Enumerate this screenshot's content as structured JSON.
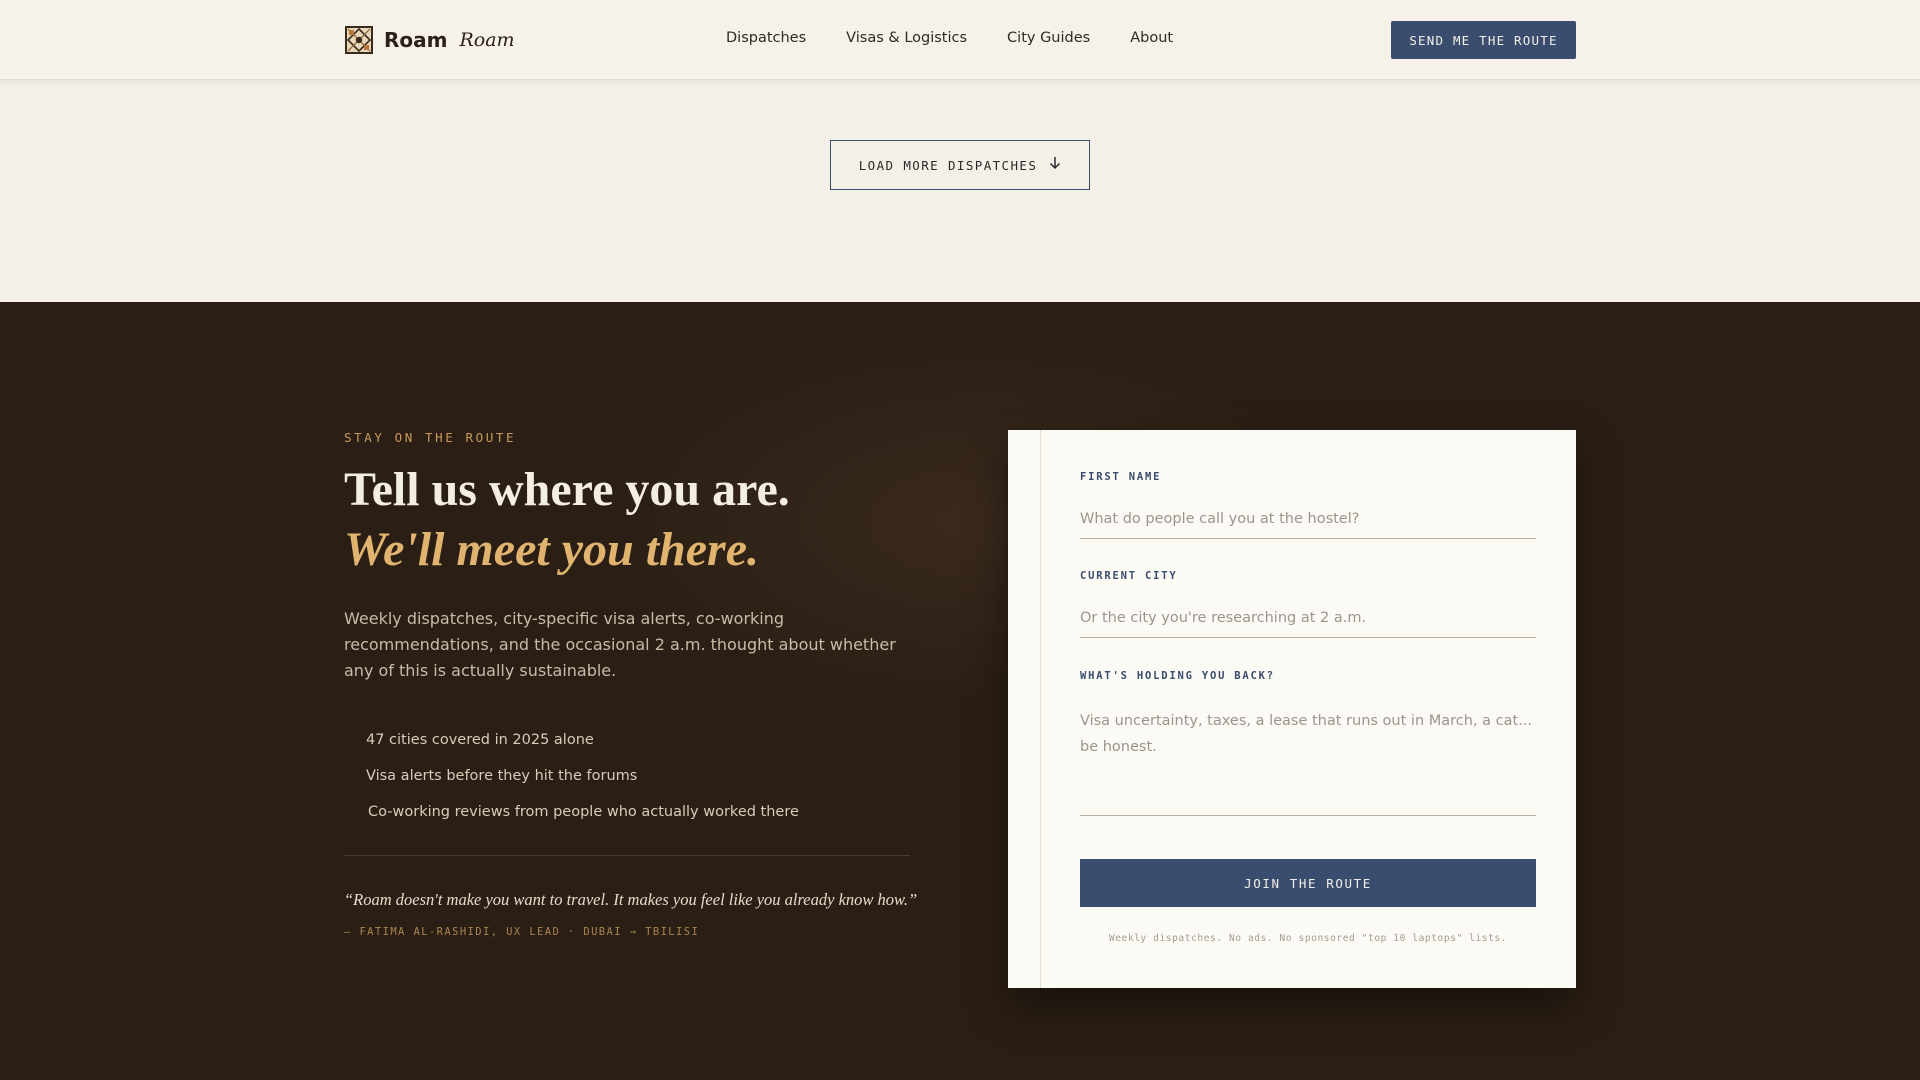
{
  "header": {
    "brand_name": "Roam",
    "brand_tagline": "Roam",
    "nav": [
      "Dispatches",
      "Visas & Logistics",
      "City Guides",
      "About"
    ],
    "cta_label": "SEND ME THE ROUTE"
  },
  "load_more": {
    "label": "LOAD MORE DISPATCHES",
    "icon": "arrow-down-icon"
  },
  "signup": {
    "eyebrow": "STAY ON THE ROUTE",
    "headline_line1": "Tell us where you are.",
    "headline_line2": "We'll meet you there.",
    "lede": "Weekly dispatches, city-specific visa alerts, co-working recommendations, and the occasional 2 a.m. thought about whether any of this is actually sustainable.",
    "bullets": [
      "47 cities covered in 2025 alone",
      "Visa alerts before they hit the forums",
      "Co-working reviews from people who actually worked there"
    ],
    "quote": "“Roam doesn't make you want to travel. It makes you feel like you already know how.”",
    "attribution": "— FATIMA AL-RASHIDI, UX LEAD · DUBAI → TBILISI"
  },
  "form": {
    "first_name_label": "FIRST NAME",
    "first_name_placeholder": "What do people call you at the hostel?",
    "first_name_value": "",
    "city_label": "CURRENT CITY",
    "city_placeholder": "Or the city you're researching at 2 a.m.",
    "city_value": "",
    "holding_label": "WHAT'S HOLDING YOU BACK?",
    "holding_placeholder": "Visa uncertainty, taxes, a lease that runs out in March, a cat... be honest.",
    "holding_value": "",
    "submit_label": "JOIN THE ROUTE",
    "fine_print": "Weekly dispatches. No ads. No sponsored \"top 10 laptops\" lists."
  },
  "colors": {
    "accent_navy": "#3a4d6e",
    "gold": "#e0b46f",
    "dark_bg": "#2b1f15",
    "light_bg": "#f4f0e8"
  }
}
